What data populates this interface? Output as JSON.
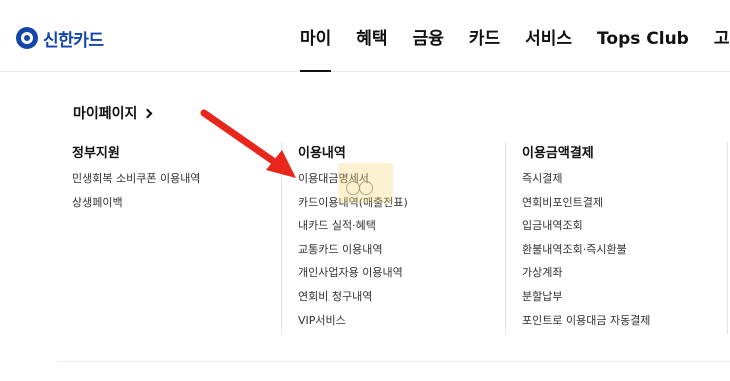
{
  "brand": {
    "name": "신한카드",
    "color": "#1446a8"
  },
  "gnb": {
    "items": [
      "마이",
      "혜택",
      "금융",
      "카드",
      "서비스",
      "Tops Club",
      "고객"
    ],
    "active_index": 0
  },
  "panel": {
    "mypage_label": "마이페이지",
    "chevron_icon": "chevron-right-icon",
    "columns": [
      {
        "title": "정부지원",
        "items": [
          "민생회복 소비쿠폰 이용내역",
          "상생페이백"
        ]
      },
      {
        "title": "이용내역",
        "items": [
          "이용대금명세서",
          "카드이용내역(매출전표)",
          "내카드 실적·혜택",
          "교통카드 이용내역",
          "개인사업자용 이용내역",
          "연회비 청구내역",
          "VIP서비스"
        ]
      },
      {
        "title": "이용금액결제",
        "items": [
          "즉시결제",
          "연회비포인트결제",
          "입금내역조회",
          "환불내역조회·즉시환불",
          "가상계좌",
          "분할납부",
          "포인트로 이용대금 자동결제"
        ]
      }
    ]
  },
  "annotation": {
    "arrow_color": "#e8261c",
    "highlight_color": "#f6d678"
  }
}
